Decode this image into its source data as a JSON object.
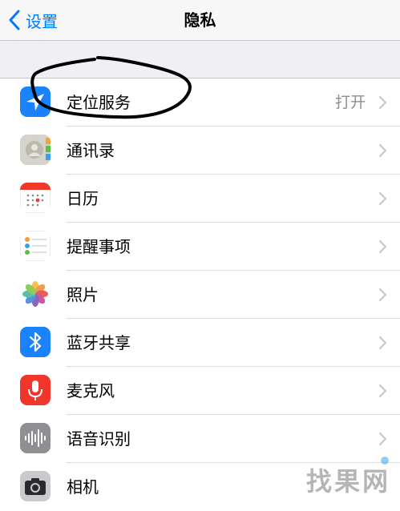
{
  "nav": {
    "back_label": "设置",
    "title": "隐私"
  },
  "rows": [
    {
      "label": "定位服务",
      "value": "打开",
      "icon": "location-arrow-icon"
    },
    {
      "label": "通讯录",
      "icon": "contacts-icon"
    },
    {
      "label": "日历",
      "icon": "calendar-icon"
    },
    {
      "label": "提醒事项",
      "icon": "reminders-icon"
    },
    {
      "label": "照片",
      "icon": "photos-icon"
    },
    {
      "label": "蓝牙共享",
      "icon": "bluetooth-icon"
    },
    {
      "label": "麦克风",
      "icon": "microphone-icon"
    },
    {
      "label": "语音识别",
      "icon": "speech-waveform-icon"
    },
    {
      "label": "相机",
      "icon": "camera-icon"
    }
  ],
  "watermark": {
    "text": [
      "找",
      "果",
      "网"
    ]
  },
  "colors": {
    "accent": "#007aff",
    "separator": "#c8c7cc",
    "background": "#efeff4",
    "annotation": "#000000"
  }
}
